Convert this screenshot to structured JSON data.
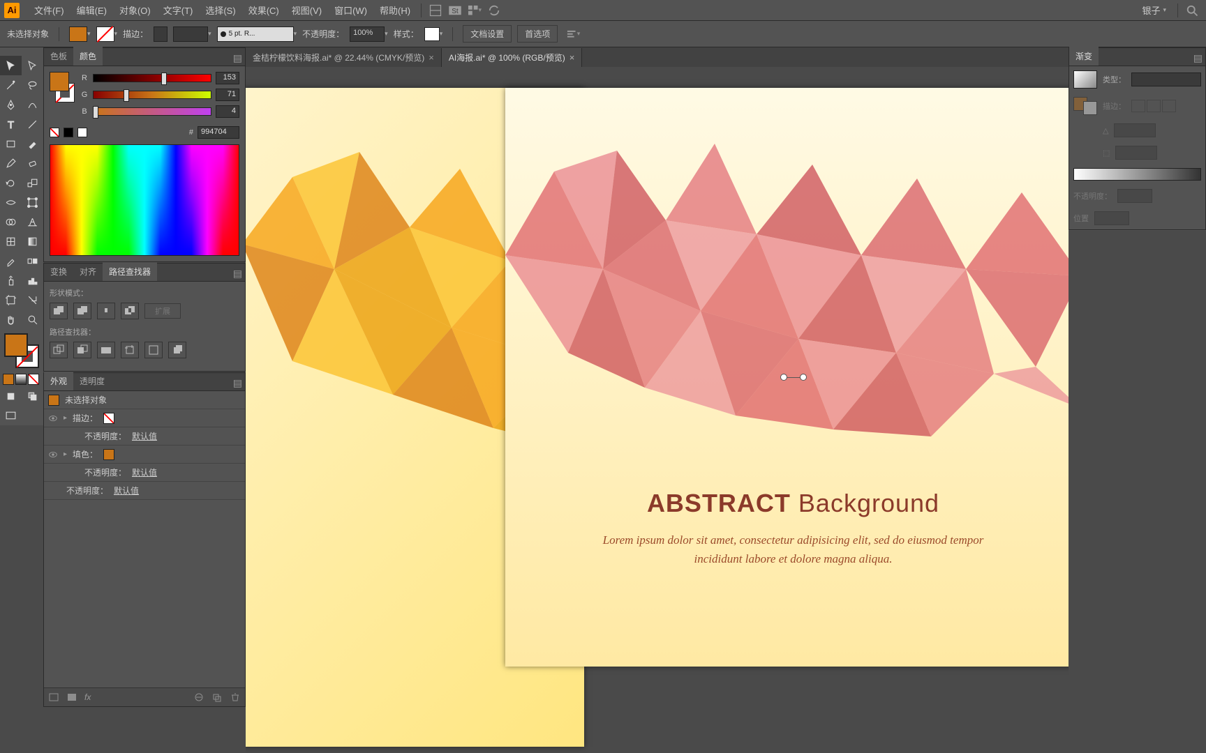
{
  "menubar": {
    "items": [
      "文件(F)",
      "编辑(E)",
      "对象(O)",
      "文字(T)",
      "选择(S)",
      "效果(C)",
      "视图(V)",
      "窗口(W)",
      "帮助(H)"
    ],
    "workspace": "银子"
  },
  "controlbar": {
    "no_selection": "未选择对象",
    "stroke_label": "描边：",
    "stroke_profile": "5 pt. R...",
    "opacity_label": "不透明度：",
    "opacity_value": "100%",
    "style_label": "样式：",
    "doc_setup": "文档设置",
    "preferences": "首选项"
  },
  "color_panel": {
    "tabs": [
      "色板",
      "颜色"
    ],
    "r": "153",
    "g": "71",
    "b": "4",
    "hex_label": "#",
    "hex": "994704"
  },
  "pathfinder": {
    "tabs": [
      "变换",
      "对齐",
      "路径查找器"
    ],
    "shape_mode": "形状模式：",
    "expand": "扩展",
    "pathfinder_label": "路径查找器："
  },
  "appearance": {
    "tabs": [
      "外观",
      "透明度"
    ],
    "no_selection": "未选择对象",
    "stroke": "描边：",
    "opacity": "不透明度：",
    "default": "默认值",
    "fill": "填色："
  },
  "doc_tabs": {
    "tab1": "金桔柠檬饮料海报.ai* @ 22.44% (CMYK/预览)",
    "tab2": "AI海报.ai* @ 100% (RGB/预览)"
  },
  "artwork": {
    "title_strong": "ABSTRACT",
    "title_rest": " Background",
    "lorem1": "Lorem ipsum dolor sit amet, consectetur adipisicing elit, sed do eiusmod tempor incididunt labore et dolore magna aliqua."
  },
  "gradient": {
    "tab": "渐变",
    "type_label": "类型：",
    "stroke_label": "描边：",
    "opacity_label": "不透明度：",
    "location_label": "位置"
  }
}
